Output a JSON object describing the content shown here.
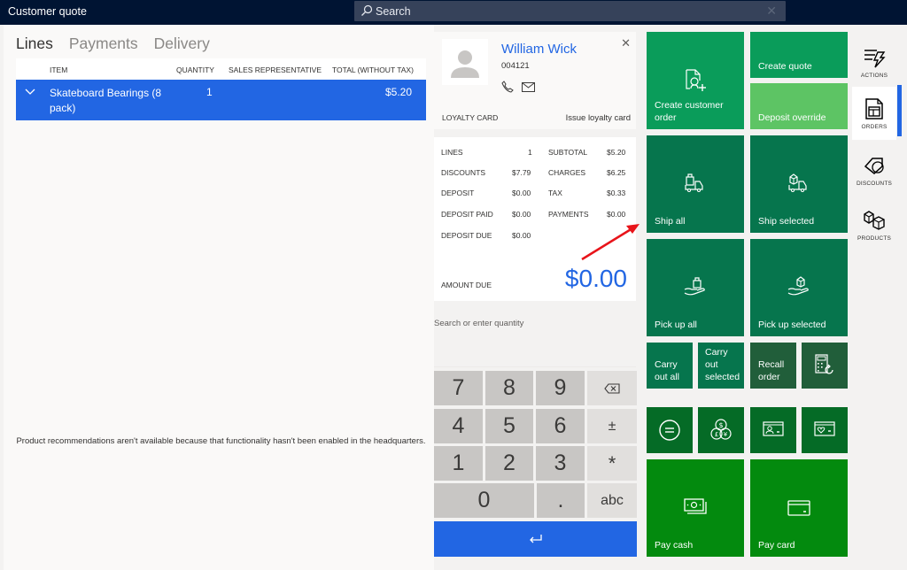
{
  "titlebar": {
    "title": "Customer quote",
    "search_placeholder": "Search",
    "search_icon": "search-icon",
    "clear_icon": "close-icon"
  },
  "lines_panel": {
    "tabs": [
      {
        "label": "Lines",
        "active": true
      },
      {
        "label": "Payments",
        "active": false
      },
      {
        "label": "Delivery",
        "active": false
      }
    ],
    "columns": [
      "ITEM",
      "QUANTITY",
      "SALES REPRESENTATIVE",
      "TOTAL (WITHOUT TAX)"
    ],
    "rows": [
      {
        "item": "Skateboard Bearings (8 pack)",
        "quantity": "1",
        "sales_rep": "",
        "total": "$5.20",
        "selected": true
      }
    ],
    "recommendations_message": "Product recommendations aren't available because that functionality hasn't been enabled in the headquarters."
  },
  "customer": {
    "name": "William Wick",
    "id": "004121",
    "loyalty_label": "LOYALTY CARD",
    "loyalty_action": "Issue loyalty card"
  },
  "totals": {
    "left": [
      {
        "label": "LINES",
        "value": "1"
      },
      {
        "label": "DISCOUNTS",
        "value": "$7.79"
      },
      {
        "label": "DEPOSIT",
        "value": "$0.00"
      },
      {
        "label": "DEPOSIT PAID",
        "value": "$0.00"
      },
      {
        "label": "DEPOSIT DUE",
        "value": "$0.00"
      }
    ],
    "right": [
      {
        "label": "SUBTOTAL",
        "value": "$5.20"
      },
      {
        "label": "CHARGES",
        "value": "$6.25"
      },
      {
        "label": "TAX",
        "value": "$0.33"
      },
      {
        "label": "PAYMENTS",
        "value": "$0.00"
      }
    ],
    "amount_due_label": "AMOUNT DUE",
    "amount_due_value": "$0.00"
  },
  "numpad": {
    "input_placeholder": "Search or enter quantity",
    "keys": [
      "7",
      "8",
      "9",
      "⌫",
      "4",
      "5",
      "6",
      "±",
      "1",
      "2",
      "3",
      "*",
      "0",
      ".",
      "abc"
    ],
    "enter_icon": "enter-icon"
  },
  "tiles": {
    "create_customer_order": "Create customer order",
    "create_quote": "Create quote",
    "deposit_override": "Deposit override",
    "ship_all": "Ship all",
    "ship_selected": "Ship selected",
    "pick_up_all": "Pick up all",
    "pick_up_selected": "Pick up selected",
    "carry_out_all": "Carry out all",
    "carry_out_selected": "Carry out selected",
    "recall_order": "Recall order",
    "pay_cash": "Pay cash",
    "pay_card": "Pay card"
  },
  "sidebar": {
    "items": [
      {
        "label": "ACTIONS",
        "active": false
      },
      {
        "label": "ORDERS",
        "active": true
      },
      {
        "label": "DISCOUNTS",
        "active": false
      },
      {
        "label": "PRODUCTS",
        "active": false
      }
    ]
  },
  "colors": {
    "accent": "#2266e3",
    "titlebar": "#001433",
    "tile_green": "#0a9c5a",
    "tile_light_green": "#5dc464",
    "tile_dark_green": "#06754d",
    "tile_recall": "#215e3a",
    "tile_pay_small": "#056b26",
    "tile_pay": "#038a0e",
    "annotation_arrow": "#e8141a"
  }
}
